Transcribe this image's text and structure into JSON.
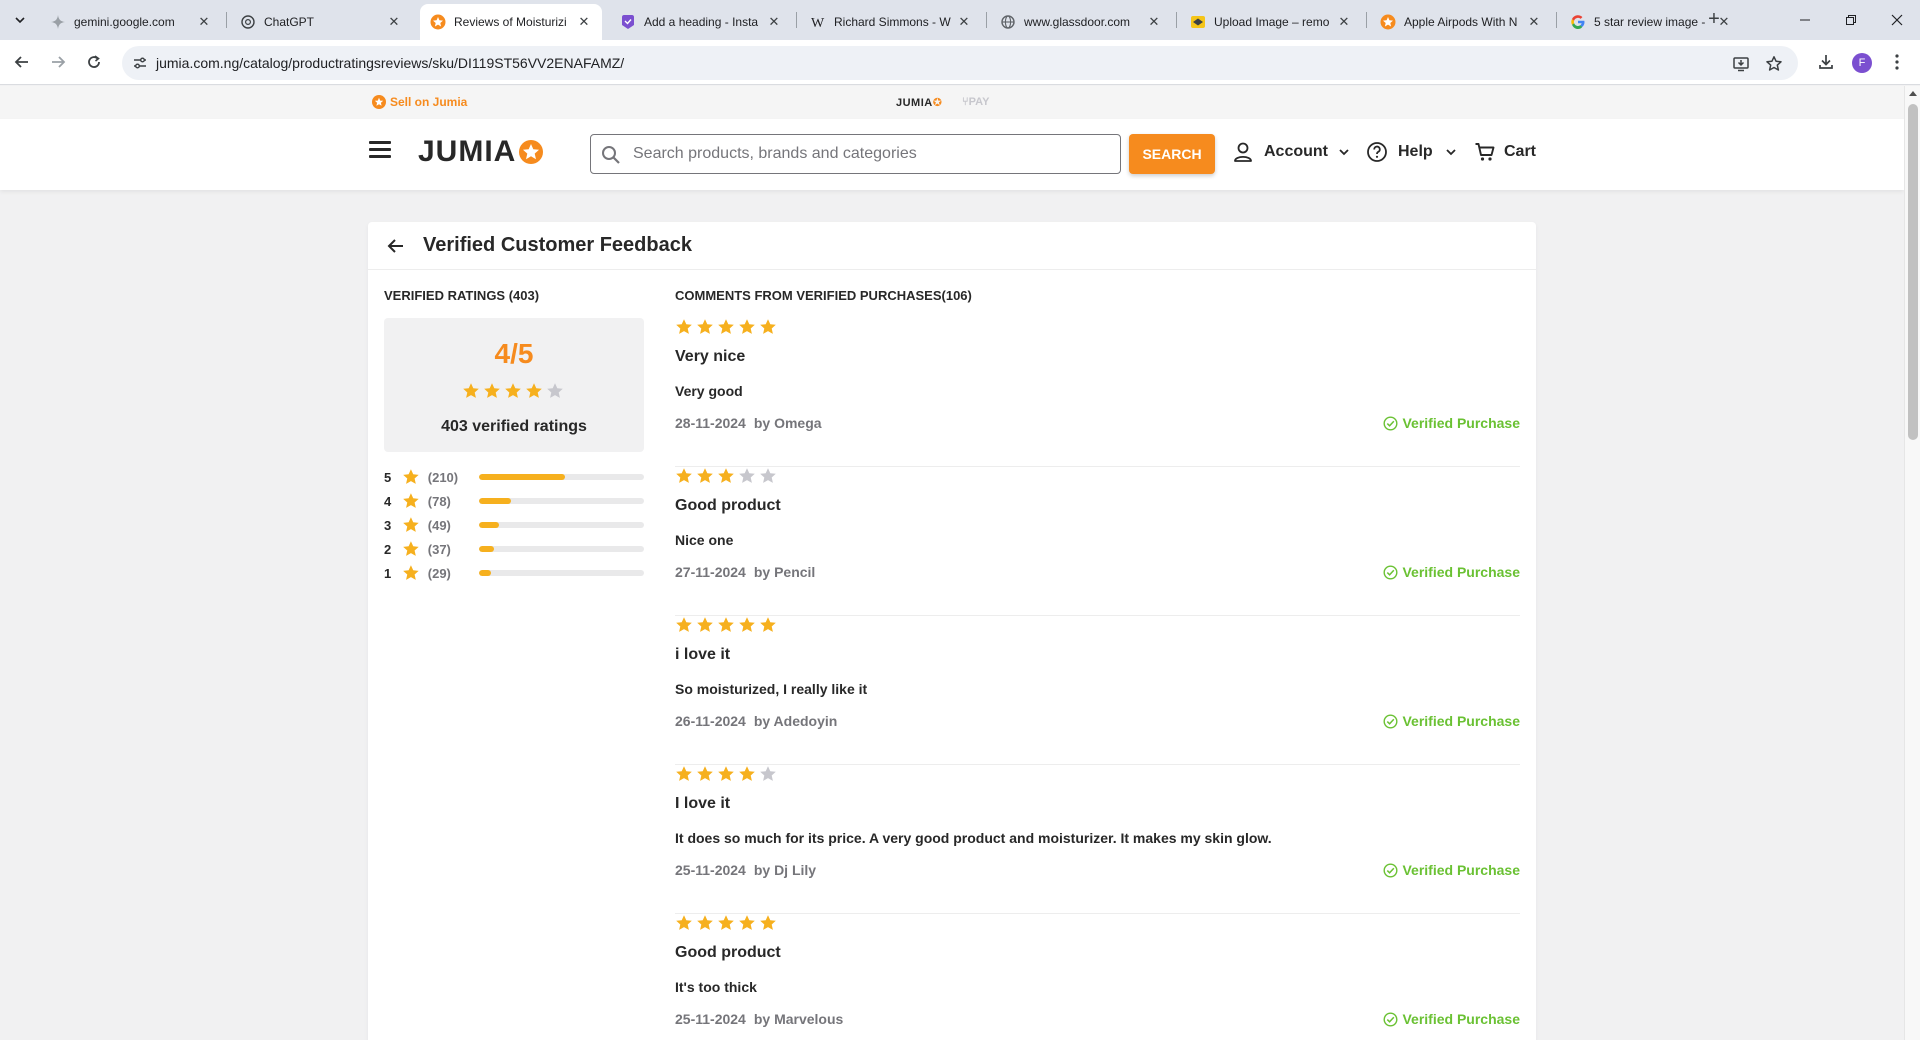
{
  "browser": {
    "tabs": [
      {
        "title": "gemini.google.com",
        "icon": "gemini-icon",
        "active": false
      },
      {
        "title": "ChatGPT",
        "icon": "chatgpt-icon",
        "active": false
      },
      {
        "title": "Reviews of Moisturizi",
        "icon": "jumia-icon",
        "active": true
      },
      {
        "title": "Add a heading - Insta",
        "icon": "canva-icon",
        "active": false
      },
      {
        "title": "Richard Simmons - W",
        "icon": "wikipedia-icon",
        "active": false
      },
      {
        "title": "www.glassdoor.com",
        "icon": "globe-icon",
        "active": false
      },
      {
        "title": "Upload Image – remo",
        "icon": "remove-bg-icon",
        "active": false
      },
      {
        "title": "Apple Airpods With N",
        "icon": "jumia-icon",
        "active": false
      },
      {
        "title": "5 star review image -",
        "icon": "google-icon",
        "active": false
      }
    ],
    "url": "jumia.com.ng/catalog/productratingsreviews/sku/DI119ST56VV2ENAFAMZ/",
    "profile_initial": "F"
  },
  "topstrip": {
    "sell_label": "Sell on Jumia",
    "brand": "JUMIA",
    "pay": "PAY"
  },
  "header": {
    "logo": "JUMIA",
    "search_placeholder": "Search products, brands and categories",
    "search_button": "SEARCH",
    "account_label": "Account",
    "help_label": "Help",
    "cart_label": "Cart"
  },
  "page": {
    "title": "Verified Customer Feedback",
    "ratings_heading": "VERIFIED RATINGS (403)",
    "comments_heading": "COMMENTS FROM VERIFIED PURCHASES(106)",
    "score": "4/5",
    "score_stars": 4,
    "verified_count_label": "403 verified ratings",
    "distribution": [
      {
        "stars": "5",
        "count": "(210)",
        "fraction": 0.521
      },
      {
        "stars": "4",
        "count": "(78)",
        "fraction": 0.194
      },
      {
        "stars": "3",
        "count": "(49)",
        "fraction": 0.122
      },
      {
        "stars": "2",
        "count": "(37)",
        "fraction": 0.092
      },
      {
        "stars": "1",
        "count": "(29)",
        "fraction": 0.072
      }
    ]
  },
  "reviews": [
    {
      "rating": 5,
      "title": "Very nice",
      "body": "Very good",
      "date": "28-11-2024",
      "author": "by Omega",
      "verified": "Verified Purchase"
    },
    {
      "rating": 3,
      "title": "Good product",
      "body": "Nice one",
      "date": "27-11-2024",
      "author": "by Pencil",
      "verified": "Verified Purchase"
    },
    {
      "rating": 5,
      "title": "i love it",
      "body": "So moisturized, I really like it",
      "date": "26-11-2024",
      "author": "by Adedoyin",
      "verified": "Verified Purchase"
    },
    {
      "rating": 4,
      "title": "I love it",
      "body": "It does so much for its price. A very good product and moisturizer. It makes my skin glow.",
      "date": "25-11-2024",
      "author": "by Dj Lily",
      "verified": "Verified Purchase"
    },
    {
      "rating": 5,
      "title": "Good product",
      "body": "It's too thick",
      "date": "25-11-2024",
      "author": "by Marvelous",
      "verified": "Verified Purchase"
    }
  ],
  "colors": {
    "accent": "#f68b1e",
    "star_filled": "#f6b01e",
    "star_empty": "#c7c7cd",
    "verified": "#6ac133"
  }
}
